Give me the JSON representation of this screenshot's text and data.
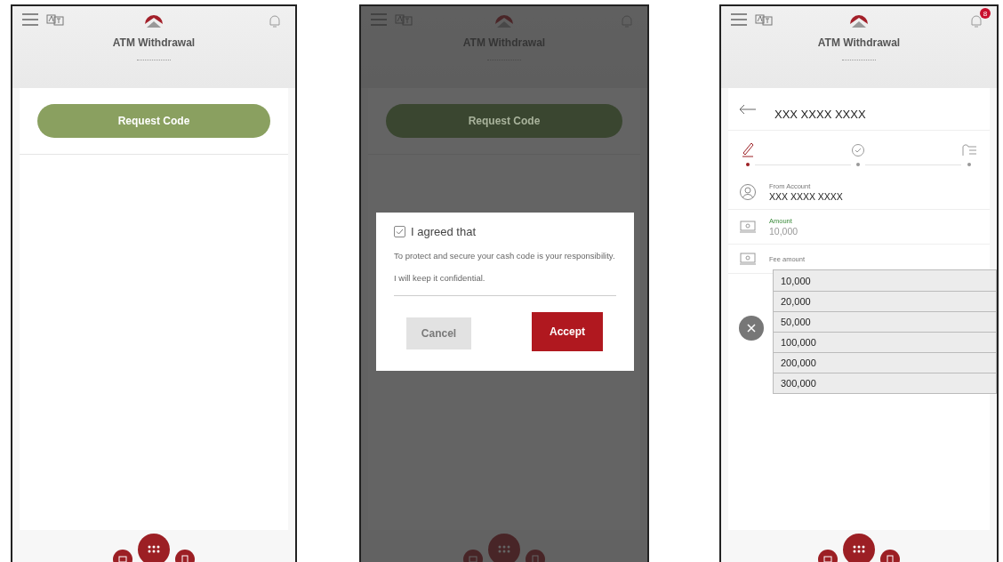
{
  "screens": [
    {
      "kind": "request",
      "dimmed": false,
      "header": {
        "title": "ATM Withdrawal"
      },
      "request_button": "Request Code"
    },
    {
      "kind": "request",
      "dimmed": true,
      "header": {
        "title": "ATM Withdrawal"
      },
      "request_button": "Request Code",
      "dialog": {
        "checkbox": {
          "label": "I agreed that",
          "checked": true
        },
        "paragraphs": [
          "To protect and secure your cash code is your responsibility.",
          "I will keep it confidential."
        ],
        "buttons": [
          {
            "label": "Cancel",
            "disabled": true
          },
          {
            "label": "Accept",
            "disabled": false
          }
        ]
      }
    },
    {
      "kind": "form",
      "dimmed": false,
      "header": {
        "title": "ATM Withdrawal",
        "notification_count": "8"
      },
      "account_title": "XXX XXXX XXXX",
      "steps": [
        {
          "selected": true
        },
        {
          "selected": false
        },
        {
          "selected": false
        }
      ],
      "fields": [
        {
          "label": "From Account",
          "value": "XXX XXXX XXXX"
        },
        {
          "label": "Amount",
          "value": "10,000"
        },
        {
          "label": "Fee amount"
        }
      ],
      "dropdown_options": [
        "10,000",
        "20,000",
        "50,000",
        "100,000",
        "200,000",
        "300,000"
      ]
    }
  ]
}
